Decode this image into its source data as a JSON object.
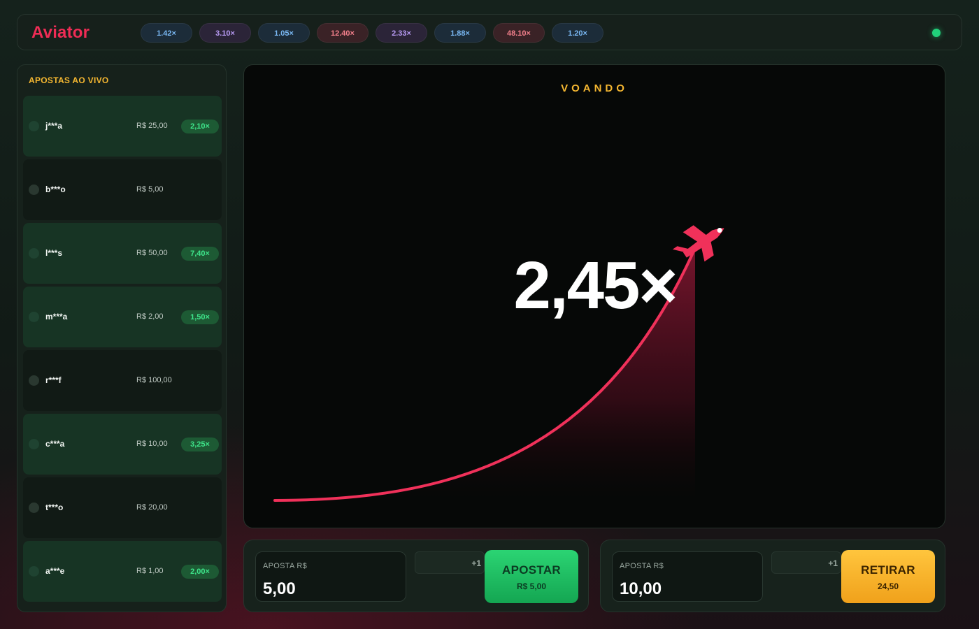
{
  "app": {
    "title": "Aviator",
    "status_color": "#21d07a"
  },
  "history": [
    {
      "value": "1.42×",
      "tone": "blue"
    },
    {
      "value": "3.10×",
      "tone": "purple"
    },
    {
      "value": "1.05×",
      "tone": "blue"
    },
    {
      "value": "12.40×",
      "tone": "red"
    },
    {
      "value": "2.33×",
      "tone": "purple"
    },
    {
      "value": "1.88×",
      "tone": "blue"
    },
    {
      "value": "48.10×",
      "tone": "red"
    },
    {
      "value": "1.20×",
      "tone": "blue"
    }
  ],
  "live_bets": {
    "title": "APOSTAS AO VIVO",
    "rows": [
      {
        "user": "j***a",
        "amount": "R$ 25,00",
        "multiplier": "2,10×"
      },
      {
        "user": "b***o",
        "amount": "R$ 5,00",
        "multiplier": ""
      },
      {
        "user": "l***s",
        "amount": "R$ 50,00",
        "multiplier": "7,40×"
      },
      {
        "user": "m***a",
        "amount": "R$ 2,00",
        "multiplier": "1,50×"
      },
      {
        "user": "r***f",
        "amount": "R$ 100,00",
        "multiplier": ""
      },
      {
        "user": "c***a",
        "amount": "R$ 10,00",
        "multiplier": "3,25×"
      },
      {
        "user": "t***o",
        "amount": "R$ 20,00",
        "multiplier": ""
      },
      {
        "user": "a***e",
        "amount": "R$ 1,00",
        "multiplier": "2,00×"
      }
    ]
  },
  "game": {
    "status": "VOANDO",
    "multiplier": "2,45×",
    "curve_color": "#f0315a",
    "plane_icon": "plane-icon"
  },
  "bets": [
    {
      "label": "APOSTA R$",
      "value": "5,00",
      "increment": "+1",
      "action_label": "APOSTAR",
      "action_sub": "R$ 5,00",
      "action_color": "#1fbd62"
    },
    {
      "label": "APOSTA R$",
      "value": "10,00",
      "increment": "+1",
      "action_label": "RETIRAR",
      "action_sub": "24,50",
      "action_color": "#f7b42c"
    }
  ]
}
